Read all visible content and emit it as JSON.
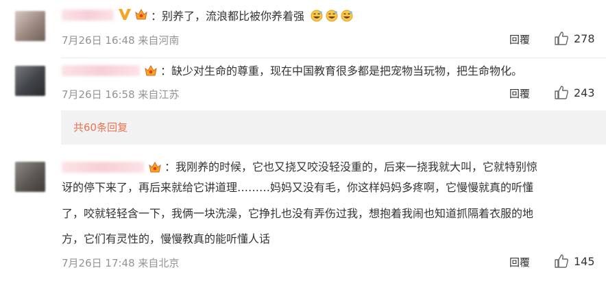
{
  "comments": [
    {
      "text": "：别养了，流浪都比被你养着强",
      "emojis": [
        "grin-sweat-icon",
        "grin-sweat-icon",
        "grin-sweat-icon"
      ],
      "date": "7月26日 16:48",
      "location": "来自河南",
      "reply_label": "回覆",
      "likes": "278",
      "vip": true
    },
    {
      "text": "：缺少对生命的尊重，现在中国教育很多都是把宠物当玩物，把生命物化。",
      "date": "7月26日 16:58",
      "location": "来自江苏",
      "reply_label": "回覆",
      "likes": "243"
    },
    {
      "lines": [
        "：我刚养的时候，它也又挠又咬没轻没重的，后来一挠我就大叫，它就特别惊",
        "讶的停下来了，再后来就给它讲道理………妈妈又没有毛，你这样妈妈多疼啊，它慢慢就真的听懂",
        "了，咬就轻轻含一下，我俩一块洗澡，它挣扎也没有弄伤过我，想抱着我闹也知道抓隔着衣服的地",
        "方，它们有灵性的，慢慢教真的能听懂人话"
      ],
      "date": "7月26日 17:48",
      "location": "来自北京",
      "reply_label": "回覆",
      "likes": "145"
    }
  ],
  "more_replies": "共60条回复",
  "colors": {
    "accent": "#eb7350",
    "meta": "#939393",
    "vip": "#f5a623"
  }
}
